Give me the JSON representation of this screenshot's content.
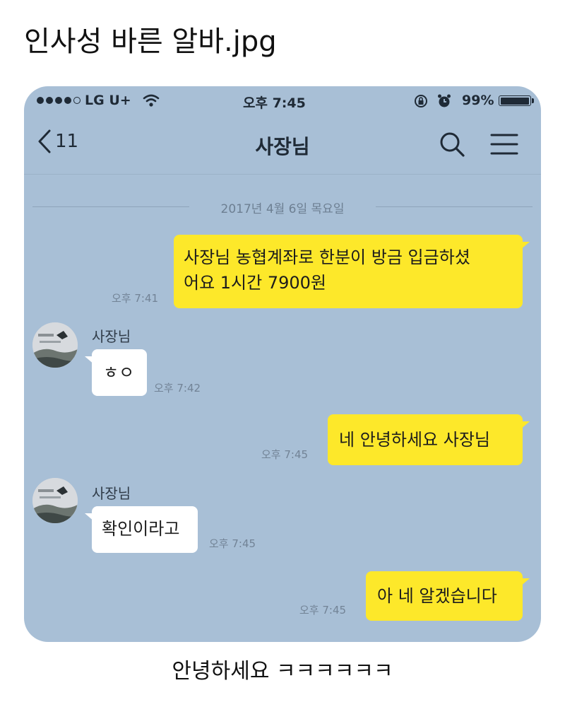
{
  "post": {
    "title": "인사성 바른 알바.jpg",
    "caption": "안녕하세요 ㅋㅋㅋㅋㅋㅋ"
  },
  "status_bar": {
    "carrier": "LG U+",
    "time": "오후 7:45",
    "battery": "99%",
    "battery_level": 0.99,
    "icons": [
      "signal-dots-icon",
      "wifi-icon",
      "rotation-lock-icon",
      "alarm-icon",
      "battery-icon"
    ]
  },
  "nav": {
    "back_count": "11",
    "title": "사장님",
    "icons": [
      "back-chevron-icon",
      "search-icon",
      "menu-icon"
    ]
  },
  "date_divider": "2017년 4월 6일 목요일",
  "messages": [
    {
      "side": "me",
      "lines": [
        "사장님 농협계좌로 한분이 방금 입금하셨",
        "어요 1시간 7900원"
      ],
      "time": "오후 7:41"
    },
    {
      "side": "other",
      "sender": "사장님",
      "lines": [
        "ㅎㅇ"
      ],
      "time": "오후 7:42"
    },
    {
      "side": "me",
      "lines": [
        "네 안녕하세요 사장님"
      ],
      "time": "오후 7:45"
    },
    {
      "side": "other",
      "sender": "사장님",
      "lines": [
        "확인이라고"
      ],
      "time": "오후 7:45"
    },
    {
      "side": "me",
      "lines": [
        "아 네 알겠습니다"
      ],
      "time": "오후 7:45"
    }
  ],
  "colors": {
    "chat_background": "#a8bfd6",
    "my_bubble": "#fde82a",
    "other_bubble": "#ffffff"
  }
}
